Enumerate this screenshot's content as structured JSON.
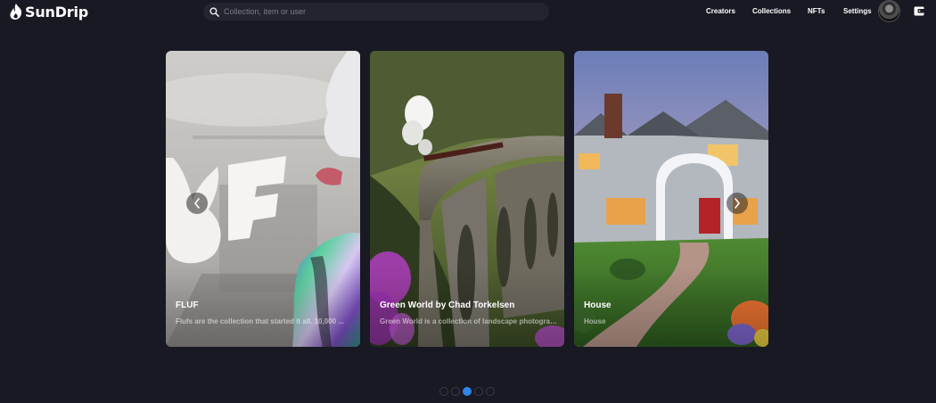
{
  "brand": {
    "name": "SunDrip",
    "icon": "flame-icon"
  },
  "search": {
    "placeholder": "Collection, item or user",
    "icon": "search-icon"
  },
  "nav": {
    "creators": "Creators",
    "collections": "Collections",
    "nfts": "NFTs",
    "settings": "Settings"
  },
  "account": {
    "avatar_icon": "avatar",
    "wallet_icon": "wallet-icon"
  },
  "carousel": {
    "prev_icon": "chevron-left-icon",
    "next_icon": "chevron-right-icon",
    "cards": [
      {
        "title": "FLUF",
        "description": "Flufs are the collection that started it all. 10,000 ...",
        "image": "fluf-rabbit-art"
      },
      {
        "title": "Green World by Chad Torkelsen",
        "description": "Green World is a collection of landscape photographs",
        "image": "viaduct-steam-train-photo"
      },
      {
        "title": "House",
        "description": "House",
        "image": "house-with-arbor-photo"
      }
    ],
    "pagination": {
      "count": 5,
      "active_index": 2
    }
  },
  "colors": {
    "background": "#181922",
    "accent": "#2f86ea",
    "search_bg": "#22242e"
  }
}
